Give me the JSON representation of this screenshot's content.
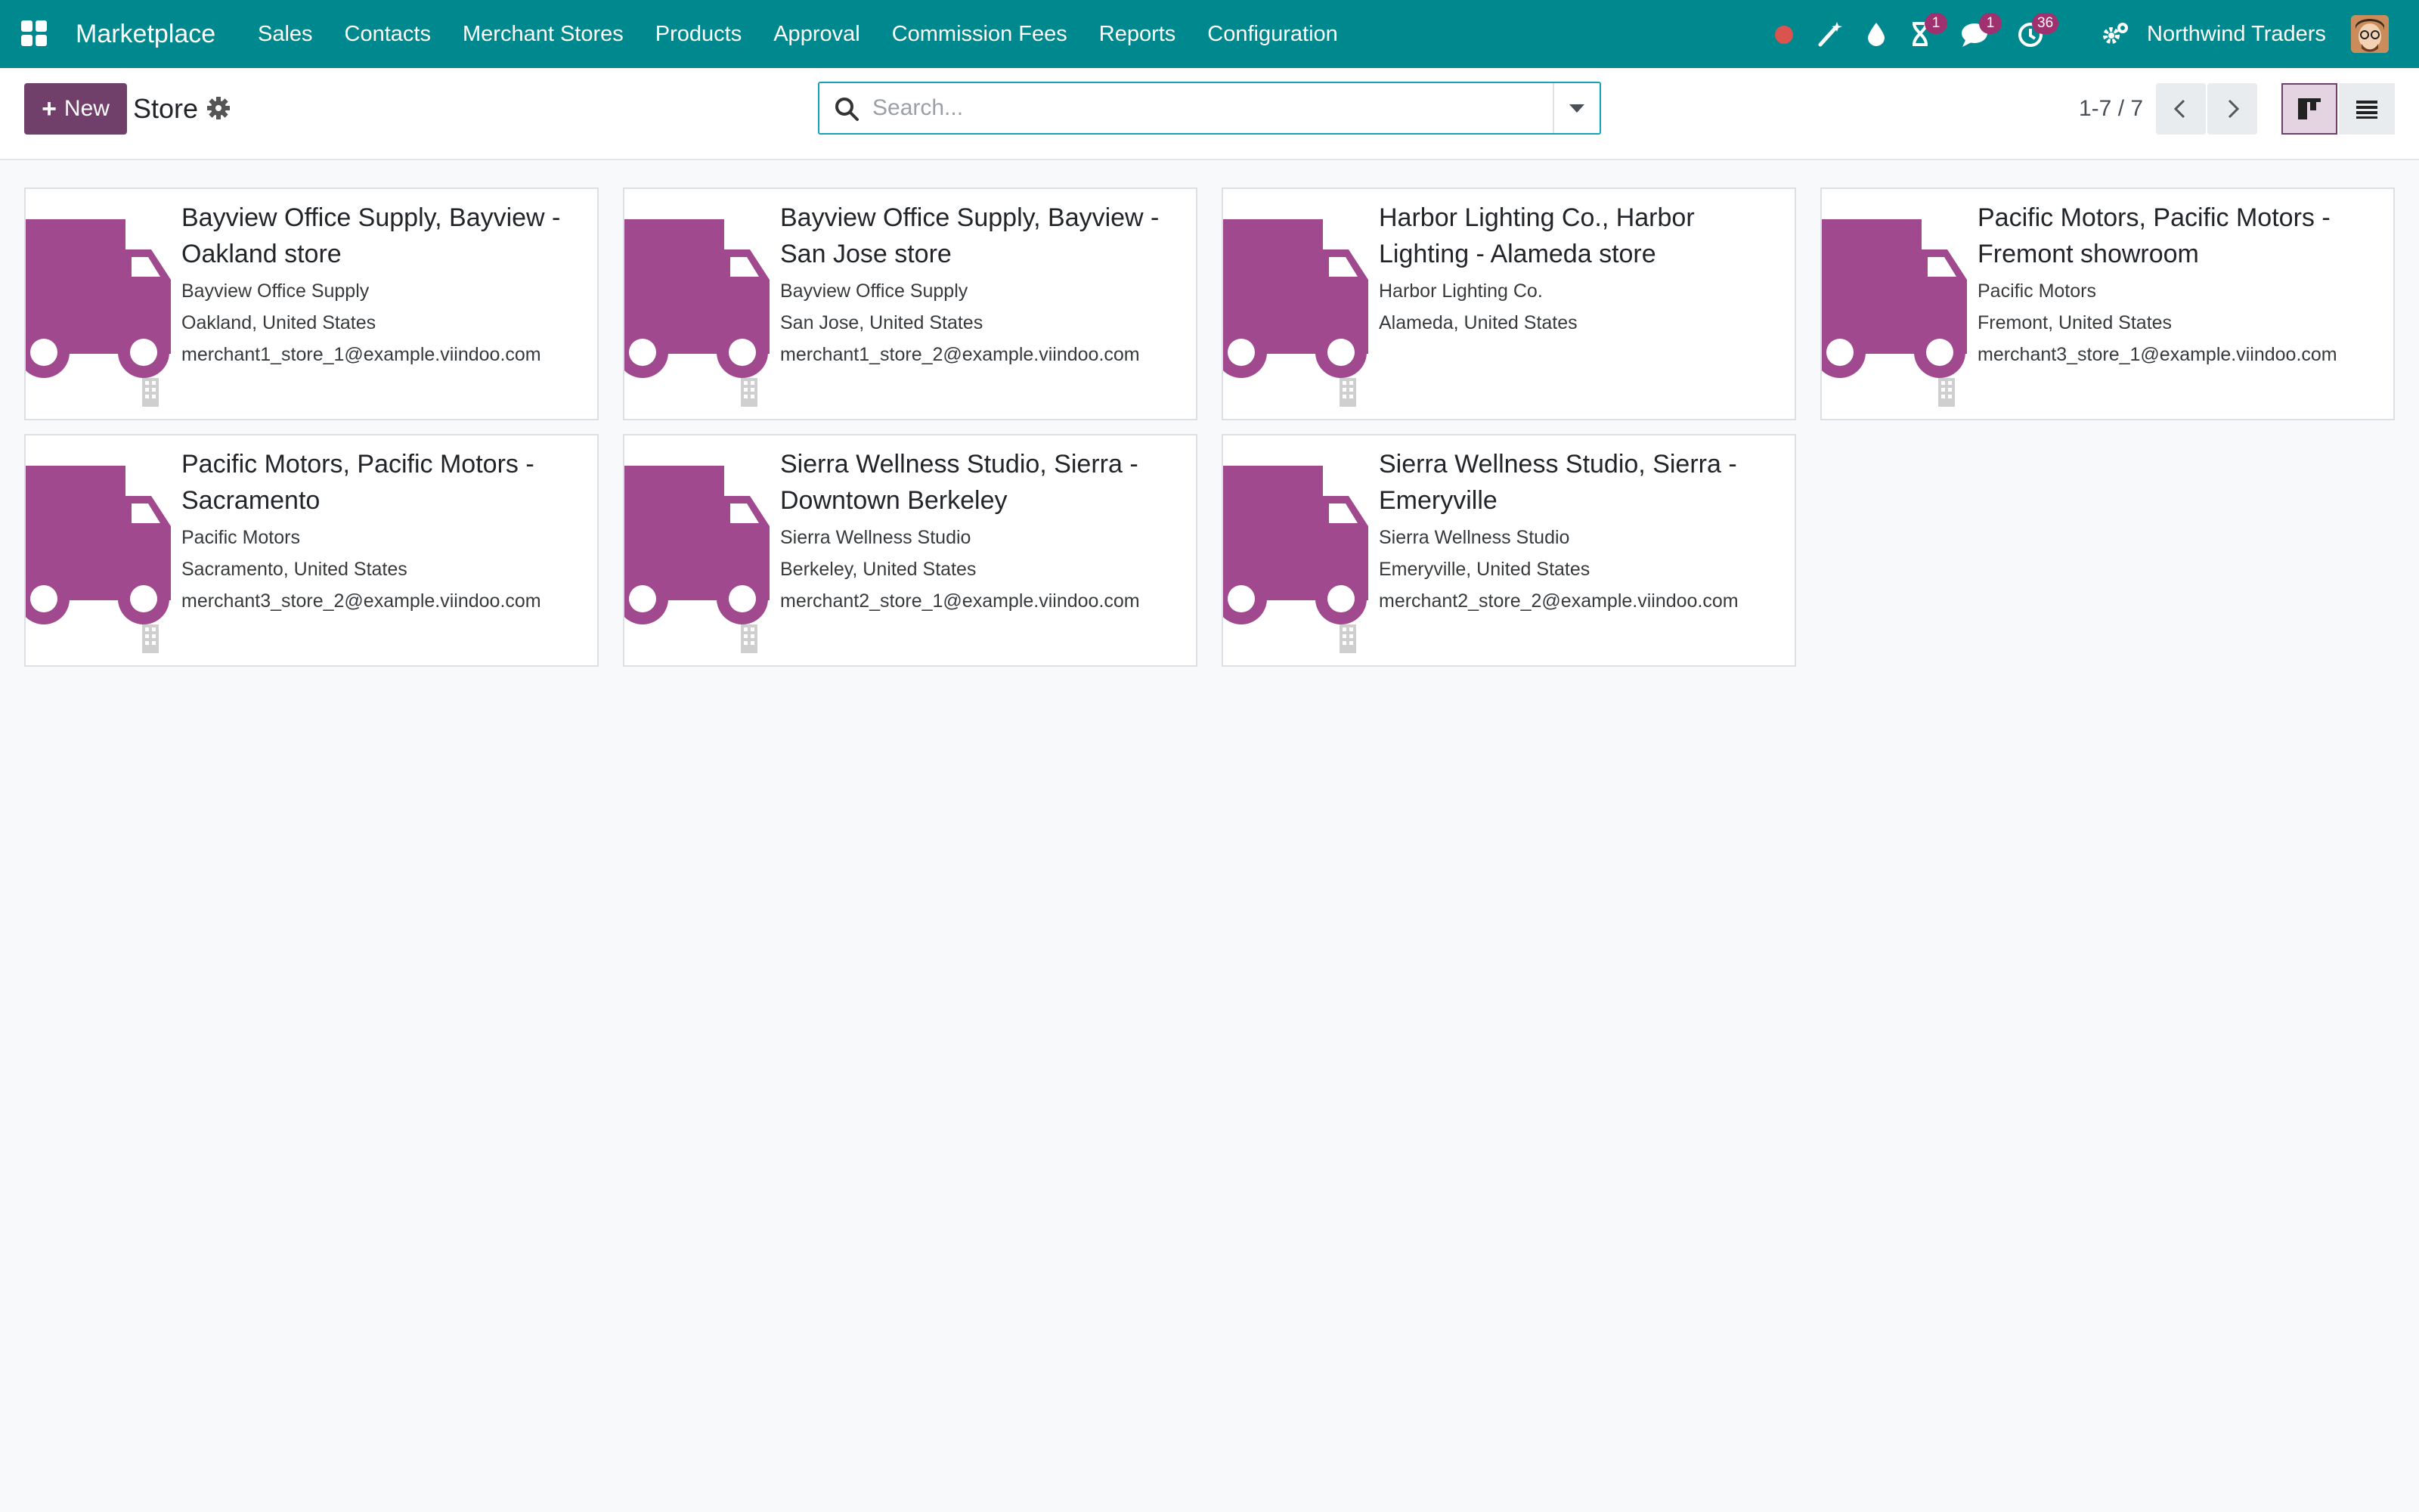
{
  "navbar": {
    "brand": "Marketplace",
    "menu": [
      "Sales",
      "Contacts",
      "Merchant Stores",
      "Products",
      "Approval",
      "Commission Fees",
      "Reports",
      "Configuration"
    ],
    "badges": {
      "activity_clock": "1",
      "messages": "1",
      "activities": "36"
    },
    "company": "Northwind Traders"
  },
  "control": {
    "new_label": "New",
    "title": "Store",
    "search_placeholder": "Search...",
    "pager": "1-7 / 7"
  },
  "colors": {
    "navbar": "#00888f",
    "primary": "#71406a",
    "truck": "#a0498e",
    "badge": "#a0316f"
  },
  "cards": [
    {
      "title": "Bayview Office Supply, Bayview - Oakland store",
      "merchant": "Bayview Office Supply",
      "location": "Oakland, United States",
      "email": "merchant1_store_1@example.viindoo.com"
    },
    {
      "title": "Bayview Office Supply, Bayview - San Jose store",
      "merchant": "Bayview Office Supply",
      "location": "San Jose, United States",
      "email": "merchant1_store_2@example.viindoo.com"
    },
    {
      "title": "Harbor Lighting Co., Harbor Lighting - Alameda store",
      "merchant": "Harbor Lighting Co.",
      "location": "Alameda, United States",
      "email": ""
    },
    {
      "title": "Pacific Motors, Pacific Motors - Fremont showroom",
      "merchant": "Pacific Motors",
      "location": "Fremont, United States",
      "email": "merchant3_store_1@example.viindoo.com"
    },
    {
      "title": "Pacific Motors, Pacific Motors - Sacramento",
      "merchant": "Pacific Motors",
      "location": "Sacramento, United States",
      "email": "merchant3_store_2@example.viindoo.com"
    },
    {
      "title": "Sierra Wellness Studio, Sierra - Downtown Berkeley",
      "merchant": "Sierra Wellness Studio",
      "location": "Berkeley, United States",
      "email": "merchant2_store_1@example.viindoo.com"
    },
    {
      "title": "Sierra Wellness Studio, Sierra - Emeryville",
      "merchant": "Sierra Wellness Studio",
      "location": "Emeryville, United States",
      "email": "merchant2_store_2@example.viindoo.com"
    }
  ]
}
